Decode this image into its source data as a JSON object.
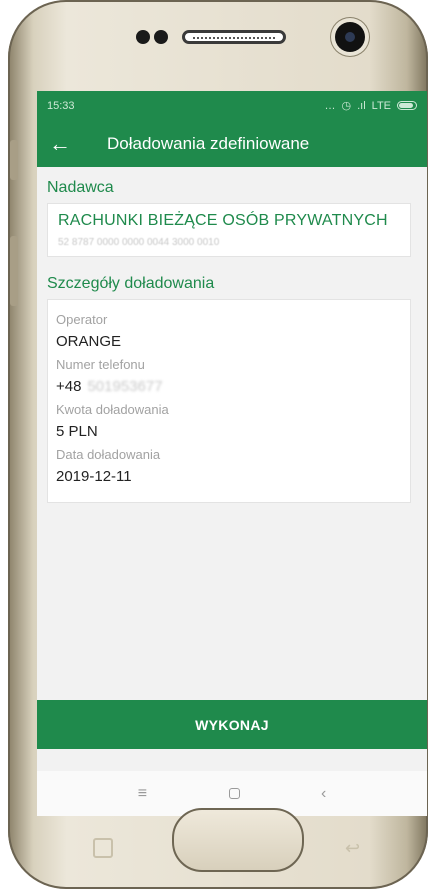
{
  "status_bar": {
    "time": "15:33",
    "network": "LTE"
  },
  "toolbar": {
    "title": "Doładowania zdefiniowane"
  },
  "sender": {
    "section_label": "Nadawca",
    "account_name": "RACHUNKI BIEŻĄCE OSÓB PRYWATNYCH",
    "account_number": "52 8787 0000 0000 0044 3000 0010"
  },
  "details": {
    "section_label": "Szczegóły doładowania",
    "fields": [
      {
        "label": "Operator",
        "value": "ORANGE"
      },
      {
        "label": "Numer telefonu",
        "prefix": "+48",
        "value": "501953677"
      },
      {
        "label": "Kwota doładowania",
        "value": "5 PLN"
      },
      {
        "label": "Data doładowania",
        "value": "2019-12-11"
      }
    ]
  },
  "action": {
    "label": "WYKONAJ"
  },
  "navbar": {
    "menu_icon": "menu-icon",
    "home_icon": "home-icon",
    "back_icon": "back-icon"
  }
}
